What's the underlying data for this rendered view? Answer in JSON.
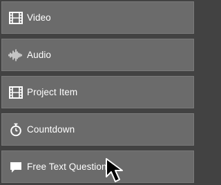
{
  "menu": {
    "items": [
      {
        "label": "Video",
        "icon": "film-strip-icon"
      },
      {
        "label": "Audio",
        "icon": "audio-waveform-icon"
      },
      {
        "label": "Project Item",
        "icon": "film-strip-icon"
      },
      {
        "label": "Countdown",
        "icon": "stopwatch-icon"
      },
      {
        "label": "Free Text Question",
        "icon": "speech-bubble-icon"
      }
    ]
  },
  "colors": {
    "background": "#424242",
    "item_background": "#6b6b6b",
    "item_border": "#7a7a7a",
    "text": "#ffffff"
  },
  "cursor": {
    "icon": "mouse-pointer-icon"
  }
}
